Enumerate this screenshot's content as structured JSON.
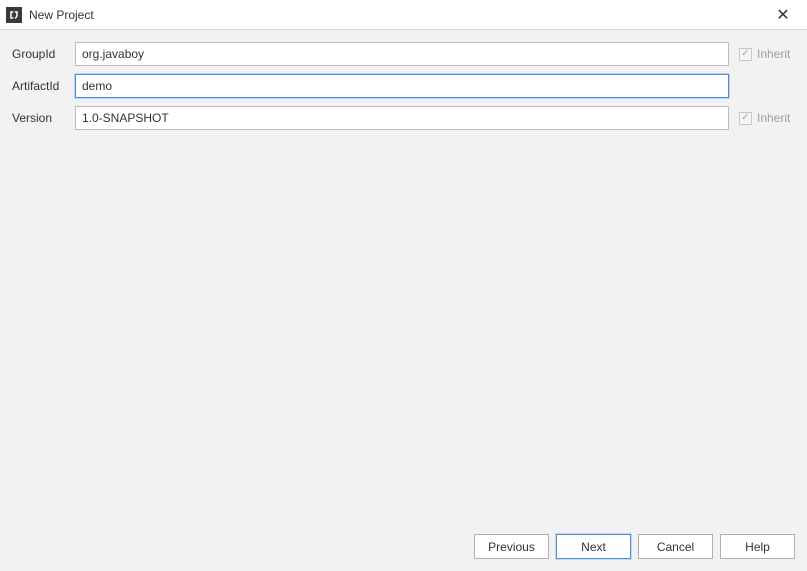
{
  "window": {
    "title": "New Project"
  },
  "form": {
    "groupId": {
      "label": "GroupId",
      "value": "org.javaboy",
      "inherit": "Inherit"
    },
    "artifactId": {
      "label": "ArtifactId",
      "value": "demo"
    },
    "version": {
      "label": "Version",
      "value": "1.0-SNAPSHOT",
      "inherit": "Inherit"
    }
  },
  "buttons": {
    "previous": "Previous",
    "next": "Next",
    "cancel": "Cancel",
    "help": "Help"
  }
}
